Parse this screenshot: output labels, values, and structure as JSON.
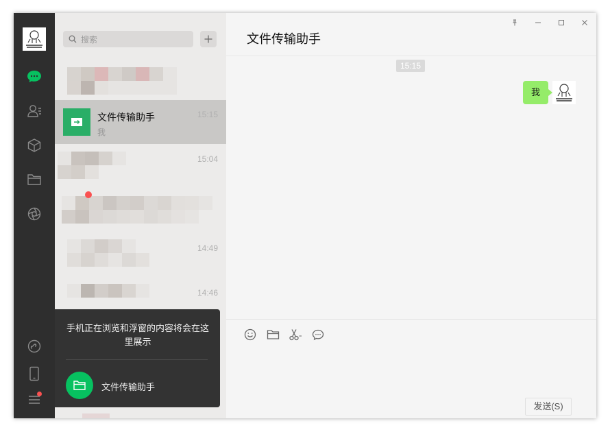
{
  "search": {
    "placeholder": "搜索"
  },
  "conversations": [
    {
      "title": "文件传输助手",
      "time": "15:15",
      "preview": "我",
      "active": true
    },
    {
      "time": "15:04"
    },
    {
      "time": "14:49"
    },
    {
      "time": "14:46"
    }
  ],
  "tooltip": {
    "message": "手机正在浏览和浮窗的内容将会在这里展示",
    "file_name": "文件传输助手"
  },
  "chat": {
    "title": "文件传输助手",
    "timestamp": "15:15",
    "messages": [
      {
        "from": "me",
        "text": "我"
      }
    ]
  },
  "composer": {
    "send_label": "发送(S)"
  },
  "colors": {
    "accent": "#07c160",
    "bubble": "#95ec69",
    "rail": "#2e2e2e"
  }
}
